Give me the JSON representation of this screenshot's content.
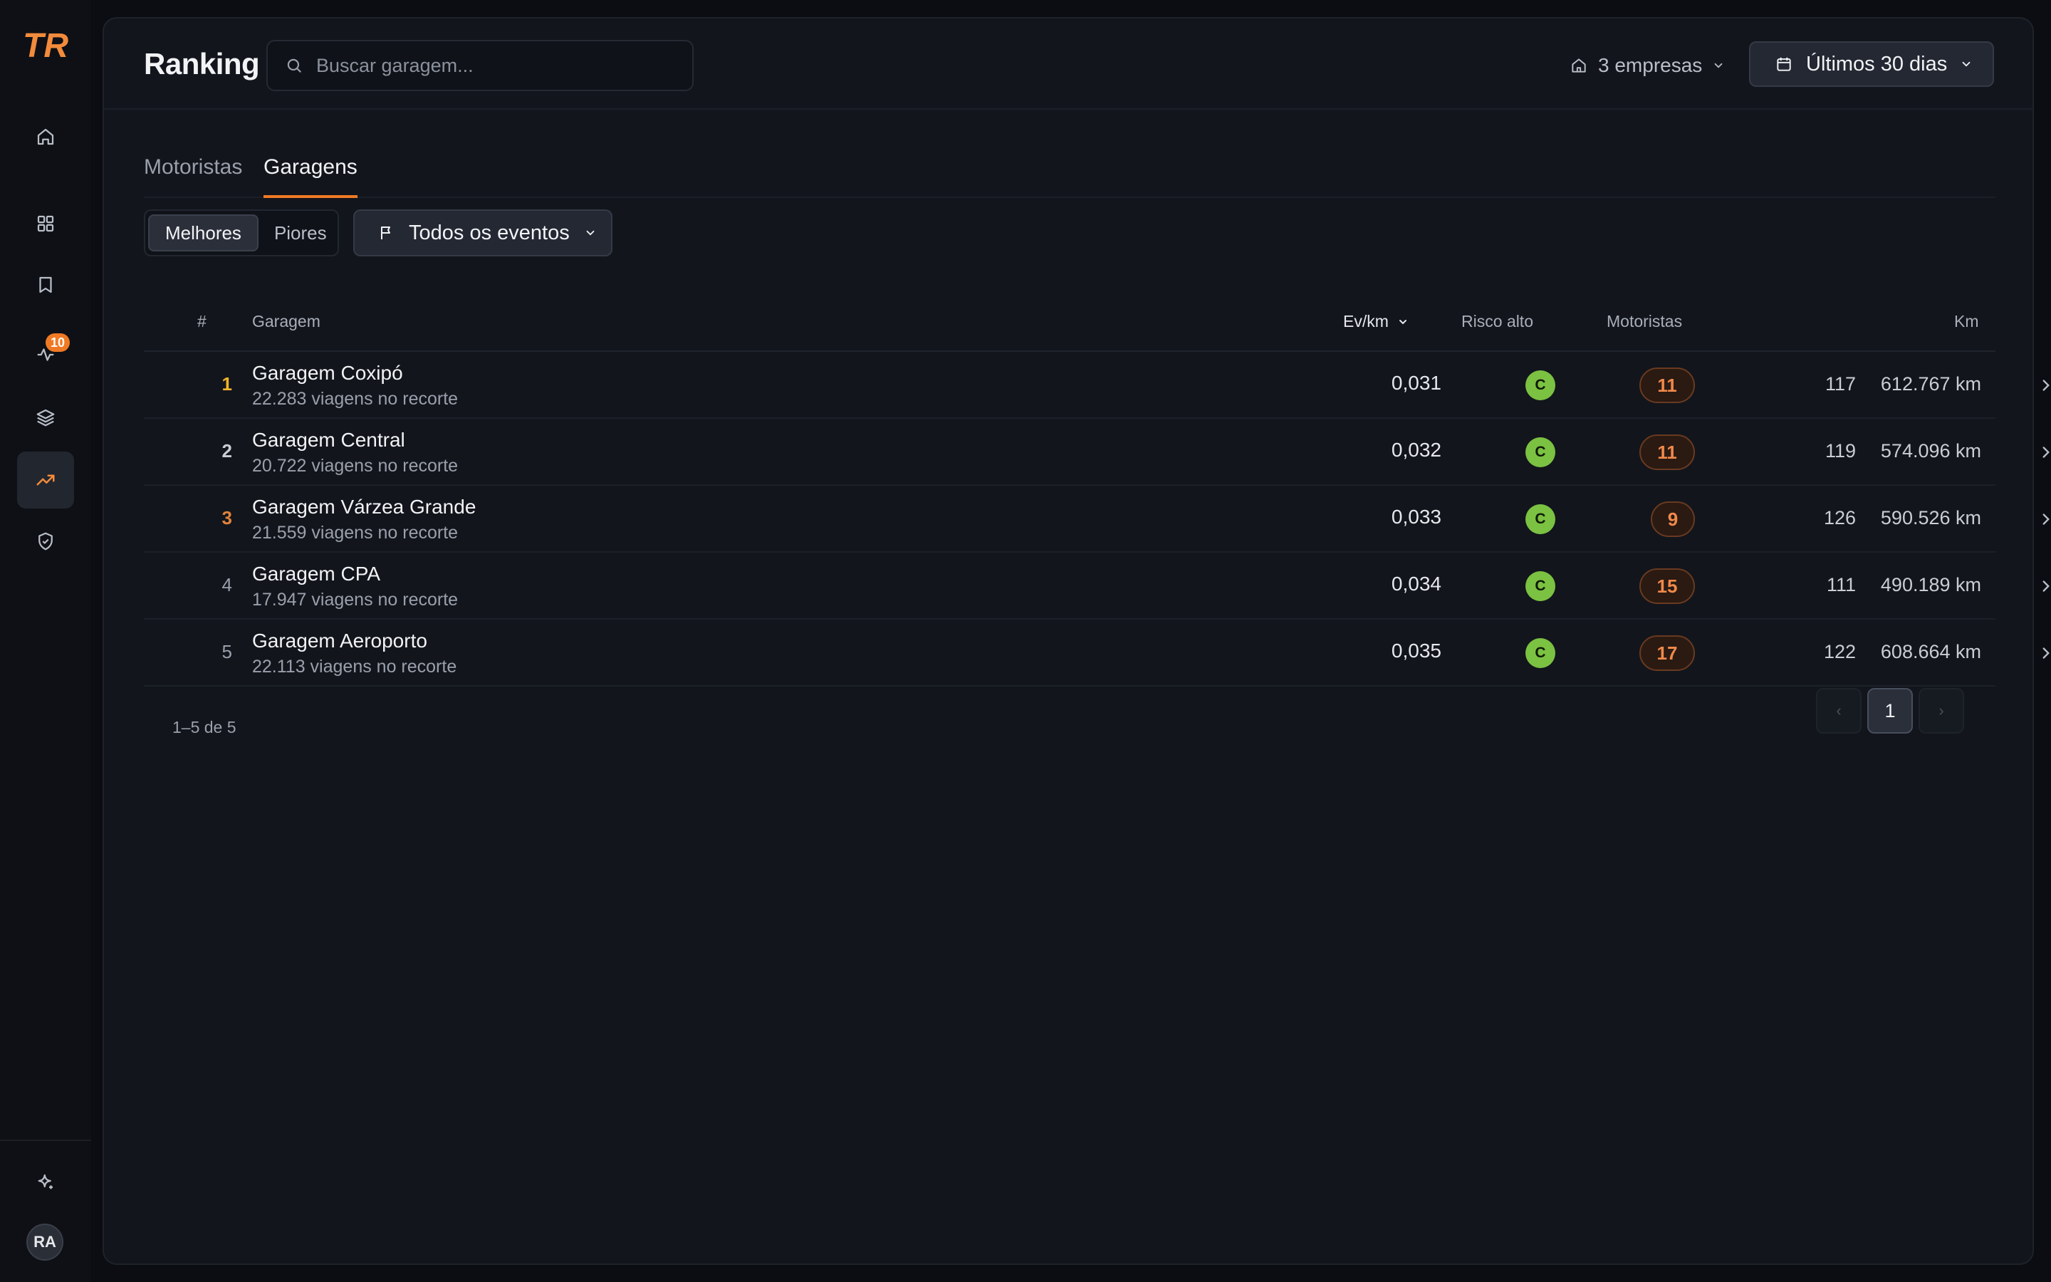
{
  "app": {
    "logo_text": "TR",
    "nav": {
      "alerts_badge": "10"
    },
    "user_initials": "RA"
  },
  "header": {
    "title": "Ranking",
    "search_placeholder": "Buscar garagem...",
    "companies_label": "3 empresas",
    "date_range_label": "Últimos 30 dias"
  },
  "tabs": [
    {
      "label": "Motoristas",
      "active": false
    },
    {
      "label": "Garagens",
      "active": true
    }
  ],
  "filters": {
    "segments": [
      {
        "label": "Melhores",
        "active": true
      },
      {
        "label": "Piores",
        "active": false
      }
    ],
    "events_label": "Todos os eventos"
  },
  "table": {
    "columns": {
      "rank": "#",
      "garage": "Garagem",
      "evkm": "Ev/km",
      "risk": "Risco alto",
      "drivers": "Motoristas",
      "km": "Km"
    },
    "rows": [
      {
        "rank": "1",
        "name": "Garagem Coxipó",
        "sub": "22.283 viagens no recorte",
        "evkm": "0,031",
        "grade": "C",
        "risk": "11",
        "drivers": "117",
        "km": "612.767 km"
      },
      {
        "rank": "2",
        "name": "Garagem Central",
        "sub": "20.722 viagens no recorte",
        "evkm": "0,032",
        "grade": "C",
        "risk": "11",
        "drivers": "119",
        "km": "574.096 km"
      },
      {
        "rank": "3",
        "name": "Garagem Várzea Grande",
        "sub": "21.559 viagens no recorte",
        "evkm": "0,033",
        "grade": "C",
        "risk": "9",
        "drivers": "126",
        "km": "590.526 km"
      },
      {
        "rank": "4",
        "name": "Garagem CPA",
        "sub": "17.947 viagens no recorte",
        "evkm": "0,034",
        "grade": "C",
        "risk": "15",
        "drivers": "111",
        "km": "490.189 km"
      },
      {
        "rank": "5",
        "name": "Garagem Aeroporto",
        "sub": "22.113 viagens no recorte",
        "evkm": "0,035",
        "grade": "C",
        "risk": "17",
        "drivers": "122",
        "km": "608.664 km"
      }
    ]
  },
  "pagination": {
    "info": "1–5 de 5",
    "current_page": "1",
    "prev_symbol": "‹",
    "next_symbol": "›"
  },
  "colors": {
    "accent": "#f07a24",
    "grade_c": "#7bc142",
    "risk_text": "#f0894a"
  }
}
